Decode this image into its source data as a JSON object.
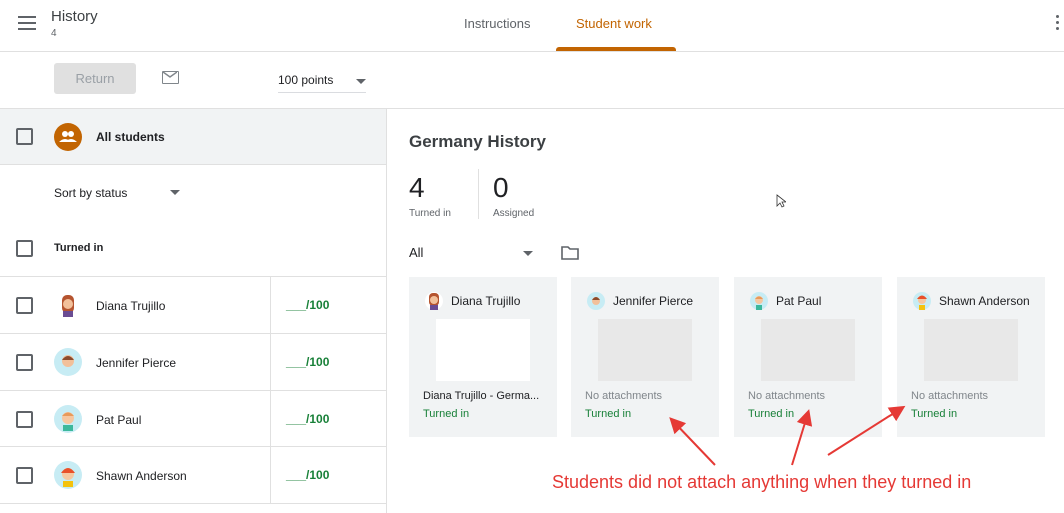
{
  "header": {
    "title": "History",
    "subtitle": "4",
    "tabs": [
      {
        "label": "Instructions"
      },
      {
        "label": "Student work"
      }
    ],
    "accent": "#c26401"
  },
  "toolbar": {
    "return_label": "Return",
    "points": "100 points"
  },
  "left": {
    "all_students": "All students",
    "sort": "Sort by status",
    "section": "Turned in",
    "students": [
      {
        "name": "Diana Trujillo",
        "grade": "___/100"
      },
      {
        "name": "Jennifer Pierce",
        "grade": "___/100"
      },
      {
        "name": "Pat Paul",
        "grade": "___/100"
      },
      {
        "name": "Shawn Anderson",
        "grade": "___/100"
      }
    ]
  },
  "main": {
    "title": "Germany History",
    "turned_in_count": "4",
    "turned_in_label": "Turned in",
    "assigned_count": "0",
    "assigned_label": "Assigned",
    "filter": "All",
    "cards": [
      {
        "name": "Diana Trujillo",
        "attachment": "Diana Trujillo - Germa...",
        "status": "Turned in"
      },
      {
        "name": "Jennifer Pierce",
        "attachment": "No attachments",
        "status": "Turned in"
      },
      {
        "name": "Pat Paul",
        "attachment": "No attachments",
        "status": "Turned in"
      },
      {
        "name": "Shawn Anderson",
        "attachment": "No attachments",
        "status": "Turned in"
      }
    ]
  },
  "annotation": {
    "text": "Students did not attach anything when they turned in",
    "color": "#e53935"
  }
}
